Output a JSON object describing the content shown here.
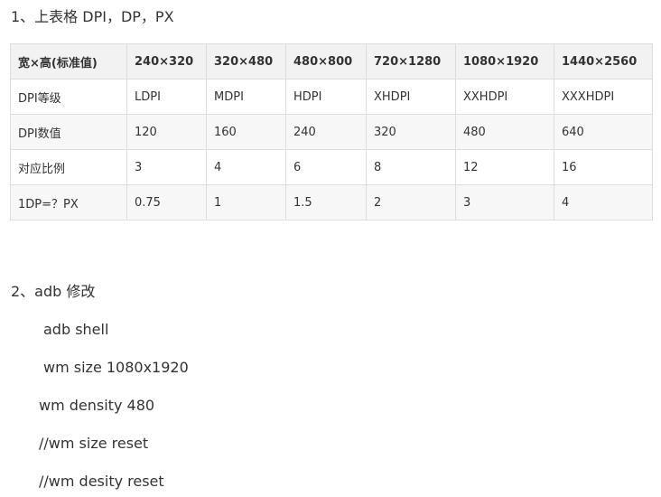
{
  "section1": {
    "heading": "1、上表格 DPI，DP，PX"
  },
  "table": {
    "headers": [
      "宽×高(标准值)",
      "240×320",
      "320×480",
      "480×800",
      "720×1280",
      "1080×1920",
      "1440×2560"
    ],
    "rows": [
      [
        "DPI等级",
        "LDPI",
        "MDPI",
        "HDPI",
        "XHDPI",
        "XXHDPI",
        "XXXHDPI"
      ],
      [
        "DPI数值",
        "120",
        "160",
        "240",
        "320",
        "480",
        "640"
      ],
      [
        "对应比例",
        "3",
        "4",
        "6",
        "8",
        "12",
        "16"
      ],
      [
        "1DP=？PX",
        "0.75",
        "1",
        "1.5",
        "2",
        "3",
        "4"
      ]
    ]
  },
  "section2": {
    "heading": "2、adb 修改",
    "commands": [
      "adb shell",
      "wm size 1080x1920",
      "wm density 480",
      "//wm size reset",
      "//wm desity reset"
    ]
  }
}
